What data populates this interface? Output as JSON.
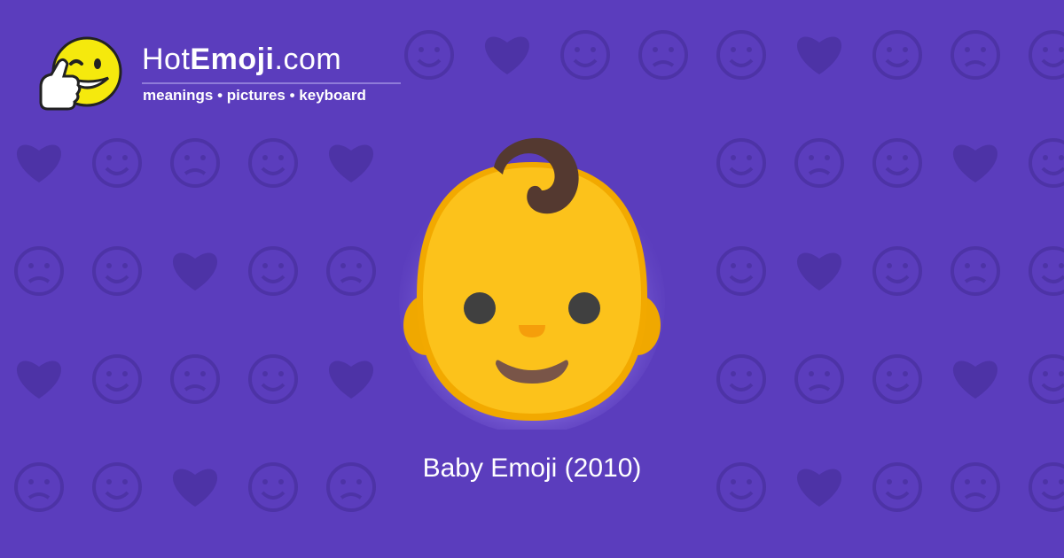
{
  "brand": {
    "name_prefix": "Hot",
    "name_bold": "Emoji",
    "name_suffix": ".com",
    "tagline": "meanings • pictures • keyboard",
    "mascot_icon": "thumbs-up-winking-face-icon"
  },
  "hero": {
    "emoji_icon": "baby-face-icon",
    "caption": "Baby Emoji (2010)"
  },
  "colors": {
    "background": "#5b3dbd",
    "pattern": "#4d33a6",
    "face": "#fcc21b",
    "hair": "#543930"
  }
}
